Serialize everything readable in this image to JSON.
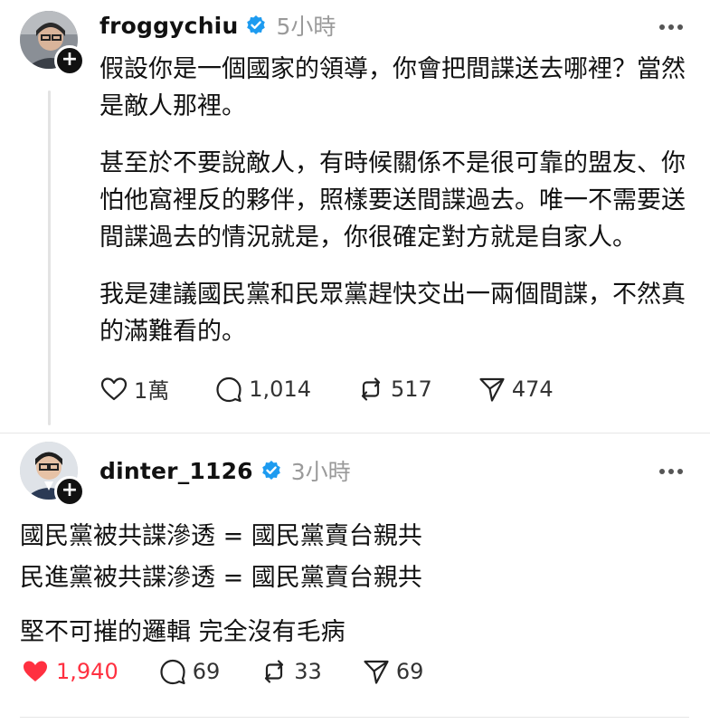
{
  "posts": [
    {
      "username": "froggychiu",
      "time": "5小時",
      "paragraphs": [
        "假設你是一個國家的領導，你會把間諜送去哪裡？當然是敵人那裡。",
        "甚至於不要說敵人，有時候關係不是很可靠的盟友、你怕他窩裡反的夥伴，照樣要送間諜過去。唯一不需要送間諜過去的情況就是，你很確定對方就是自家人。",
        "我是建議國民黨和民眾黨趕快交出一兩個間諜，不然真的滿難看的。"
      ],
      "likes": "1萬",
      "comments": "1,014",
      "reposts": "517",
      "shares": "474"
    },
    {
      "username": "dinter_1126",
      "time": "3小時",
      "lines": [
        "國民黨被共諜滲透 = 國民黨賣台親共",
        "民進黨被共諜滲透 = 國民黨賣台親共",
        "堅不可摧的邏輯 完全沒有毛病"
      ],
      "likes": "1,940",
      "comments": "69",
      "reposts": "33",
      "shares": "69"
    }
  ],
  "colors": {
    "verified": "#1d9bf0",
    "liked": "#ff3040",
    "muted": "#9a9a9a"
  },
  "icons": [
    "verified-icon",
    "more-icon",
    "heart-icon",
    "comment-icon",
    "repost-icon",
    "share-icon",
    "plus-icon"
  ]
}
